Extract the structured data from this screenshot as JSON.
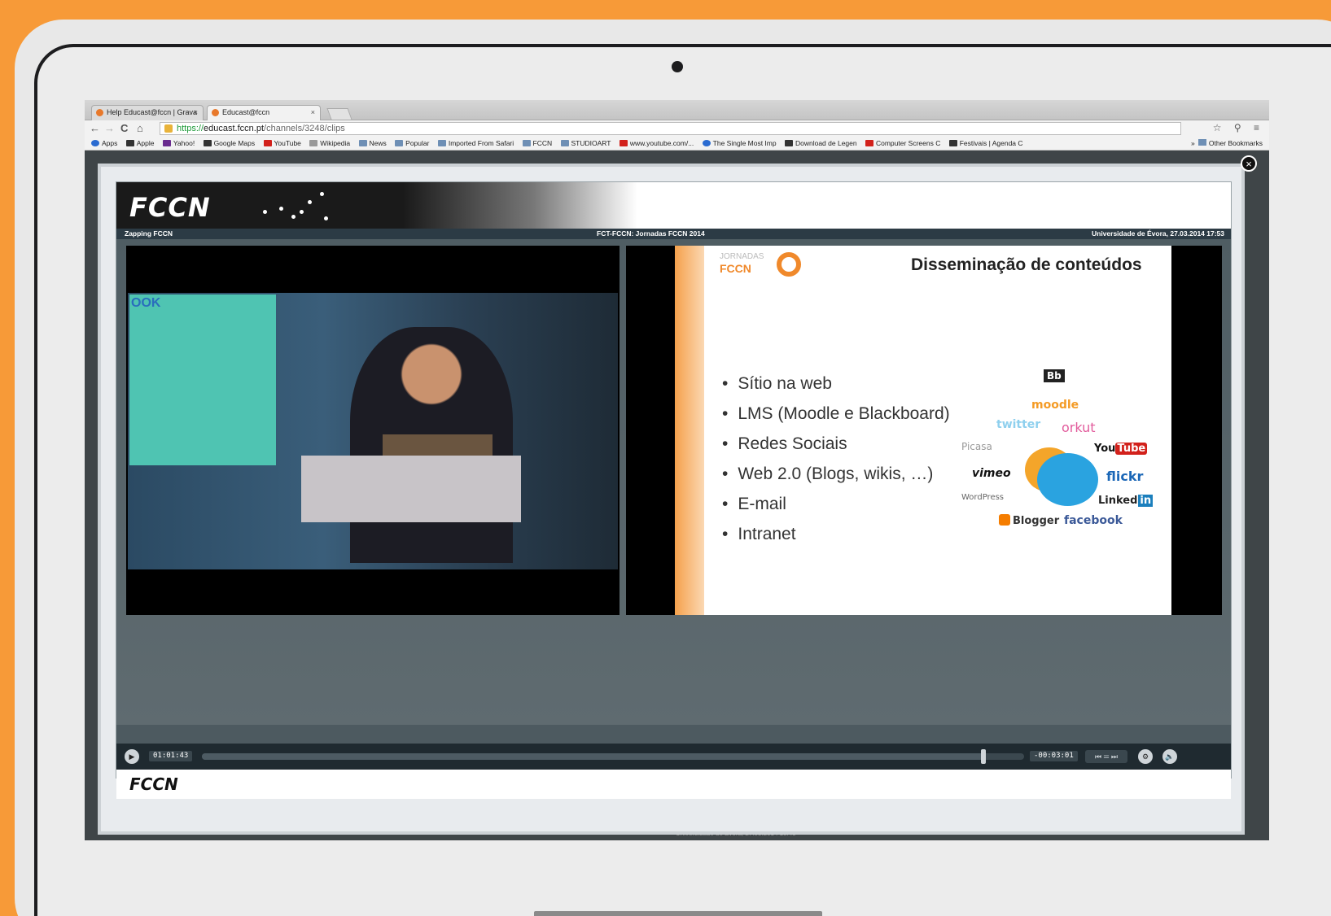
{
  "browser": {
    "tabs": [
      {
        "label": "Help Educast@fccn | Grava"
      },
      {
        "label": "Educast@fccn"
      }
    ],
    "nav": {
      "back": "←",
      "forward": "→",
      "reload": "C",
      "home": "⌂"
    },
    "url": {
      "scheme": "https://",
      "host": "educast.fccn.pt",
      "path": "/channels/3248/clips"
    },
    "toolbar_right": "☆ ⚲ ≡",
    "bookmarks": [
      {
        "label": "Apps",
        "icon": "apps-icon"
      },
      {
        "label": "Apple",
        "icon": "apple-icon"
      },
      {
        "label": "Yahoo!",
        "icon": "yahoo-icon"
      },
      {
        "label": "Google Maps",
        "icon": "maps-icon"
      },
      {
        "label": "YouTube",
        "icon": "youtube-icon"
      },
      {
        "label": "Wikipedia",
        "icon": "wikipedia-icon"
      },
      {
        "label": "News",
        "icon": "folder-icon"
      },
      {
        "label": "Popular",
        "icon": "folder-icon"
      },
      {
        "label": "Imported From Safari",
        "icon": "folder-icon"
      },
      {
        "label": "FCCN",
        "icon": "folder-icon"
      },
      {
        "label": "STUDIOART",
        "icon": "folder-icon"
      },
      {
        "label": "www.youtube.com/...",
        "icon": "youtube-icon"
      },
      {
        "label": "The Single Most Imp",
        "icon": "globe-icon"
      },
      {
        "label": "Download de Legen",
        "icon": "download-icon"
      },
      {
        "label": "Computer Screens C",
        "icon": "nn-icon"
      },
      {
        "label": "Festivais | Agenda C",
        "icon": "festival-icon"
      }
    ],
    "bookmarks_more": "»",
    "other_bookmarks": "Other Bookmarks"
  },
  "player": {
    "close": "×",
    "logo": "FCCN",
    "info_left": "Zapping FCCN",
    "info_center": "FCT-FCCN: Jornadas FCCN 2014",
    "info_right": "Universidade de Évora, 27.03.2014 17:53",
    "video_screen_text": "OOK",
    "slide": {
      "logo_small": "JORNADAS",
      "logo": "FCCN",
      "title": "Disseminação de conteúdos",
      "bullets": [
        "Sítio na web",
        "LMS (Moodle e Blackboard)",
        "Redes Sociais",
        "Web 2.0 (Blogs, wikis, …)",
        "E-mail",
        "Intranet"
      ],
      "logos": {
        "blackboard": "Bb",
        "moodle": "moodle",
        "twitter": "twitter",
        "orkut": "orkut",
        "picasa": "Picasa",
        "youtube_a": "You",
        "youtube_b": "Tube",
        "vimeo": "vimeo",
        "flickr": "flickr",
        "wordpress": "WordPress",
        "linkedin_a": "Linked",
        "linkedin_b": "in",
        "blogger": "Blogger",
        "facebook": "facebook"
      }
    },
    "controls": {
      "play": "▶",
      "elapsed": "01:01:43",
      "remaining": "-00:03:01",
      "progress": 0.95,
      "chapters": "⏮ ☰ ⏭",
      "settings": "⚙",
      "volume": "🔈"
    },
    "footer_logo": "FCCN"
  },
  "page_behind": {
    "bottom_text": "Universidade de Évora, 27.03.2014 18:43"
  },
  "colors": {
    "background": "#f79a38",
    "brand_orange": "#f0892b",
    "player_bg": "#4d5a60"
  }
}
